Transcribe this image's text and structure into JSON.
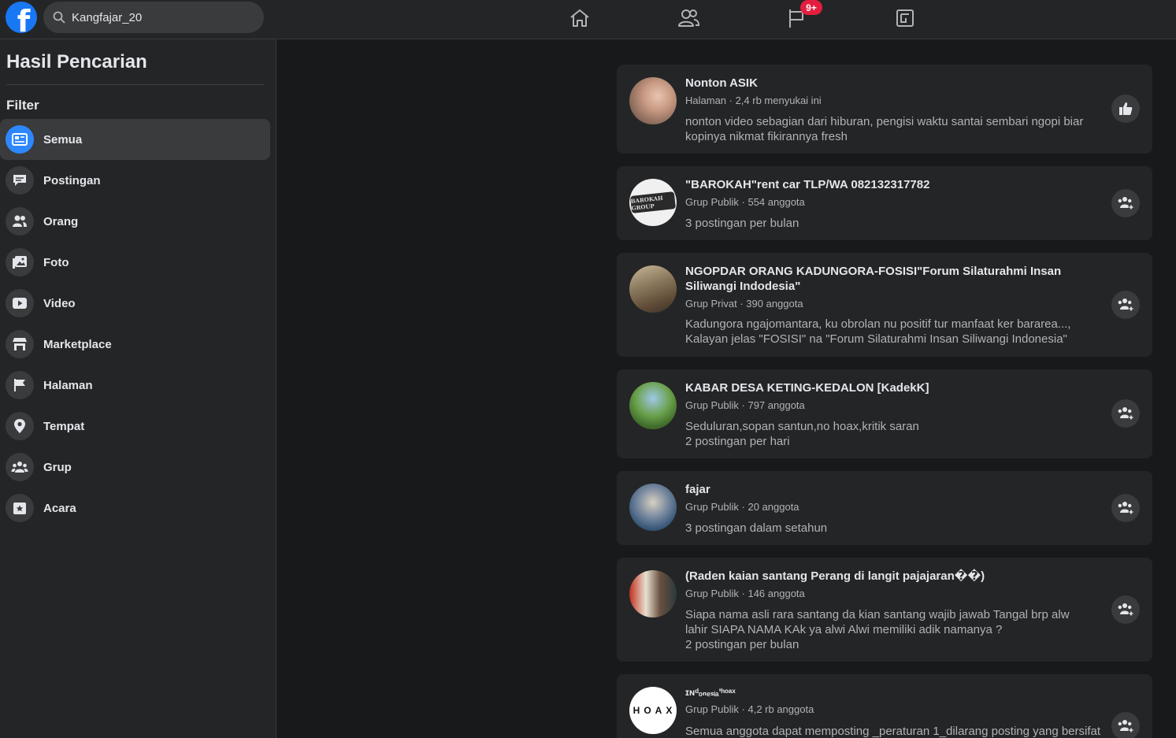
{
  "search": {
    "value": "Kangfajar_20"
  },
  "header": {
    "notification_badge": "9+"
  },
  "sidebar": {
    "title": "Hasil Pencarian",
    "filter_label": "Filter",
    "items": [
      {
        "label": "Semua",
        "icon": "all-results-icon"
      },
      {
        "label": "Postingan",
        "icon": "posts-icon"
      },
      {
        "label": "Orang",
        "icon": "people-icon"
      },
      {
        "label": "Foto",
        "icon": "photos-icon"
      },
      {
        "label": "Video",
        "icon": "video-icon"
      },
      {
        "label": "Marketplace",
        "icon": "marketplace-icon"
      },
      {
        "label": "Halaman",
        "icon": "flag-icon"
      },
      {
        "label": "Tempat",
        "icon": "location-pin-icon"
      },
      {
        "label": "Grup",
        "icon": "groups-icon"
      },
      {
        "label": "Acara",
        "icon": "calendar-star-icon"
      }
    ]
  },
  "results": [
    {
      "name": "Nonton ASIK",
      "meta": "Halaman · 2,4 rb menyukai ini",
      "desc": "nonton video sebagian dari hiburan, pengisi waktu santai sembari ngopi biar kopinya nikmat fikirannya fresh"
    },
    {
      "name": "\"BAROKAH\"rent car TLP/WA 082132317782",
      "meta": "Grup Publik · 554 anggota",
      "desc": "3 postingan per bulan"
    },
    {
      "name": "NGOPDAR ORANG KADUNGORA-FOSISI\"Forum Silaturahmi Insan Siliwangi Indodesia\"",
      "meta": "Grup Privat · 390 anggota",
      "desc": "Kadungora ngajomantara, ku obrolan nu positif tur manfaat ker bararea..., Kalayan jelas \"FOSISI\" na \"Forum Silaturahmi Insan Siliwangi Indonesia\""
    },
    {
      "name": "KABAR DESA KETING-KEDALON [KadekK]",
      "meta": "Grup Publik · 797 anggota",
      "desc": "Seduluran,sopan santun,no hoax,kritik saran\n2 postingan per hari"
    },
    {
      "name": "fajar",
      "meta": "Grup Publik · 20 anggota",
      "desc": "3 postingan dalam setahun"
    },
    {
      "name": "(Raden kaian santang Perang di langit pajajaran��)",
      "meta": "Grup Publik · 146 anggota",
      "desc": "Siapa nama asli rara santang da kian santang wajib jawab Tangal brp alw lahir SIAPA NAMA KAk ya alwi Alwi memiliki adik namanya ?\n2 postingan per bulan"
    },
    {
      "name": "ɪɴᵈₒₙₑₛᵢₐ'ʰᵒᵃˣ",
      "meta": "Grup Publik · 4,2 rb anggota",
      "desc": "Semua anggota dapat memposting _peraturan 1_dilarang posting yang bersifat",
      "avatar_text": "HOAX"
    }
  ],
  "barokah_logo_text": "BAROKAH GROUP",
  "colors": {
    "accent": "#2d88ff",
    "fb_blue": "#1877f2",
    "badge": "#e41e3f"
  }
}
